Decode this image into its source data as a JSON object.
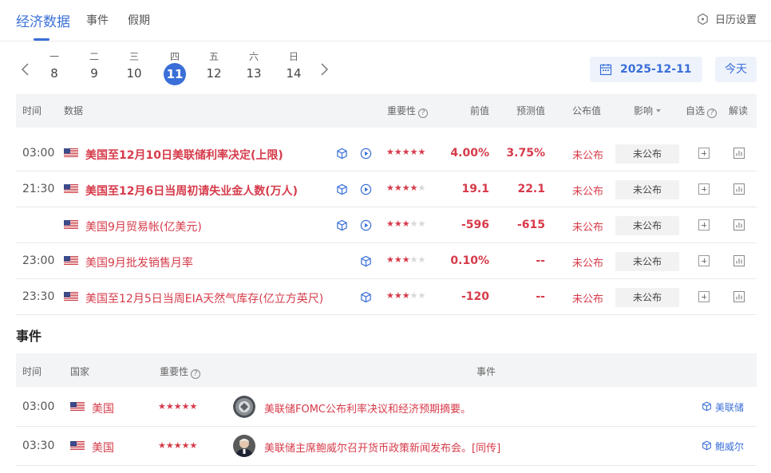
{
  "tabs": [
    {
      "label": "经济数据"
    },
    {
      "label": "事件"
    },
    {
      "label": "假期"
    }
  ],
  "settings_label": "日历设置",
  "days": [
    {
      "weekday": "一",
      "date": "8"
    },
    {
      "weekday": "二",
      "date": "9"
    },
    {
      "weekday": "三",
      "date": "10"
    },
    {
      "weekday": "四",
      "date": "11"
    },
    {
      "weekday": "五",
      "date": "12"
    },
    {
      "weekday": "六",
      "date": "13"
    },
    {
      "weekday": "日",
      "date": "14"
    }
  ],
  "selected_date": "2025-12-11",
  "today_label": "今天",
  "data_header": {
    "time": "时间",
    "data": "数据",
    "importance": "重要性",
    "previous": "前值",
    "forecast": "预测值",
    "published": "公布值",
    "impact": "影响",
    "watch": "自选",
    "explain": "解读"
  },
  "data_rows": [
    {
      "time": "03:00",
      "name": "美国至12月10日美联储利率决定(上限)",
      "bold": true,
      "icons": 2,
      "stars": 5,
      "previous": "4.00%",
      "forecast": "3.75%",
      "published": "未公布",
      "impact": "未公布"
    },
    {
      "time": "21:30",
      "name": "美国至12月6日当周初请失业金人数(万人)",
      "bold": true,
      "icons": 2,
      "stars": 4,
      "previous": "19.1",
      "forecast": "22.1",
      "published": "未公布",
      "impact": "未公布"
    },
    {
      "time": "",
      "name": "美国9月贸易帐(亿美元)",
      "bold": false,
      "icons": 2,
      "stars": 3,
      "previous": "-596",
      "forecast": "-615",
      "published": "未公布",
      "impact": "未公布"
    },
    {
      "time": "23:00",
      "name": "美国9月批发销售月率",
      "bold": false,
      "icons": 1,
      "stars": 3,
      "previous": "0.10%",
      "forecast": "--",
      "published": "未公布",
      "impact": "未公布"
    },
    {
      "time": "23:30",
      "name": "美国至12月5日当周EIA天然气库存(亿立方英尺)",
      "bold": false,
      "icons": 1,
      "stars": 3,
      "previous": "-120",
      "forecast": "--",
      "published": "未公布",
      "impact": "未公布"
    }
  ],
  "events_title": "事件",
  "events_header": {
    "time": "时间",
    "country": "国家",
    "importance": "重要性",
    "event": "事件"
  },
  "events": [
    {
      "time": "03:00",
      "country": "美国",
      "stars": 5,
      "text": "美联储FOMC公布利率决议和经济预期摘要。",
      "tag": "美联储",
      "avatar": "seal-icon"
    },
    {
      "time": "03:30",
      "country": "美国",
      "stars": 5,
      "text": "美联储主席鲍威尔召开货币政策新闻发布会。[同传]",
      "tag": "鲍威尔",
      "avatar": "person-icon"
    }
  ],
  "colors": {
    "accent": "#3a6fd8",
    "red": "#d63b4a"
  }
}
